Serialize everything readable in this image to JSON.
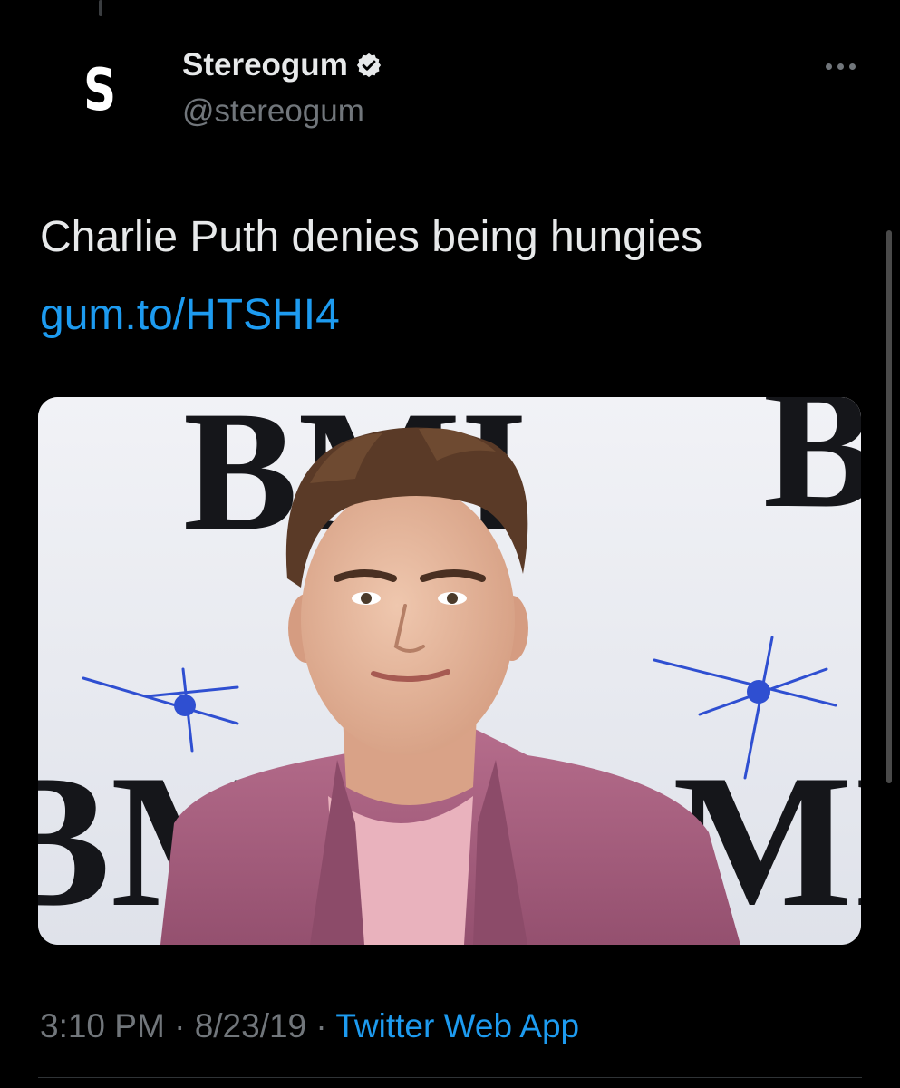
{
  "tweet": {
    "author": {
      "avatar_letter": "S",
      "display_name": "Stereogum",
      "handle": "@stereogum",
      "verified": true
    },
    "text": "Charlie Puth denies being hungies",
    "link": "gum.to/HTSHI4",
    "media": {
      "backdrop_logo_text": "BMI"
    },
    "timestamp": {
      "time": "3:10 PM",
      "separator": "·",
      "date": "8/23/19",
      "source": "Twitter Web App"
    }
  },
  "icons": {
    "verified": "verified-badge-icon",
    "more": "more-options-icon"
  },
  "colors": {
    "background": "#000000",
    "primary_text": "#e7e9ea",
    "secondary_text": "#71767b",
    "link": "#1d9bf0"
  }
}
